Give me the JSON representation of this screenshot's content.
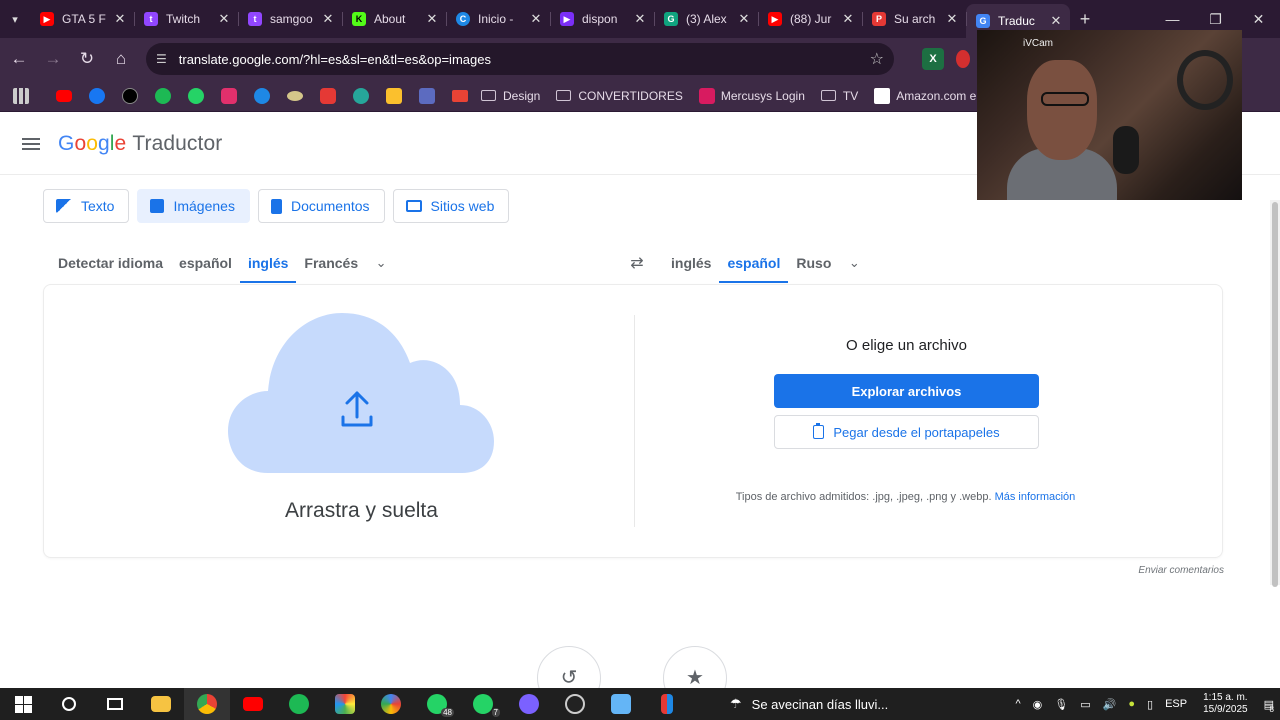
{
  "tabs": [
    {
      "title": "GTA 5 F",
      "color": "#ff0000",
      "glyph": "▶"
    },
    {
      "title": "Twitch",
      "color": "#9146ff",
      "glyph": "t"
    },
    {
      "title": "samgoo",
      "color": "#9146ff",
      "glyph": "t"
    },
    {
      "title": "About",
      "color": "#111111",
      "glyph": "K"
    },
    {
      "title": "Inicio -",
      "color": "#1e88e5",
      "glyph": "C"
    },
    {
      "title": "dispon",
      "color": "#7b2ff7",
      "glyph": "▶"
    },
    {
      "title": "(3) Alex",
      "color": "#10a37f",
      "glyph": "G"
    },
    {
      "title": "(88) Jur",
      "color": "#ff0000",
      "glyph": "▶"
    },
    {
      "title": "Su arch",
      "color": "#e53935",
      "glyph": "P"
    },
    {
      "title": "Traduc",
      "color": "#4285f4",
      "glyph": "G"
    }
  ],
  "address": {
    "url": "translate.google.com/?hl=es&sl=en&tl=es&op=images"
  },
  "bookmarks": {
    "items": [
      "Design",
      "CONVERTIDORES",
      "Mercusys Login",
      "TV",
      "Amazon.com en esp..."
    ]
  },
  "header": {
    "product": "Traductor"
  },
  "modes": [
    "Texto",
    "Imágenes",
    "Documentos",
    "Sitios web"
  ],
  "source_langs": [
    "Detectar idioma",
    "español",
    "inglés",
    "Francés"
  ],
  "target_langs": [
    "inglés",
    "español",
    "Ruso"
  ],
  "upload": {
    "drop_label": "Arrastra y suelta",
    "or_choose": "O elige un archivo",
    "browse_label": "Explorar archivos",
    "paste_label": "Pegar desde el portapapeles",
    "types_text": "Tipos de archivo admitidos: .jpg, .jpeg, .png y .webp.",
    "more_info": "Más información"
  },
  "feedback": "Enviar comentarios",
  "webcam": {
    "label": "iVCam"
  },
  "taskbar": {
    "weather": "Se avecinan días lluvi...",
    "lang": "ESP",
    "time": "1:15 a. m.",
    "date": "15/9/2025",
    "whatsapp_badge_1": "48",
    "whatsapp_badge_2": "7",
    "notif_count": "8"
  }
}
